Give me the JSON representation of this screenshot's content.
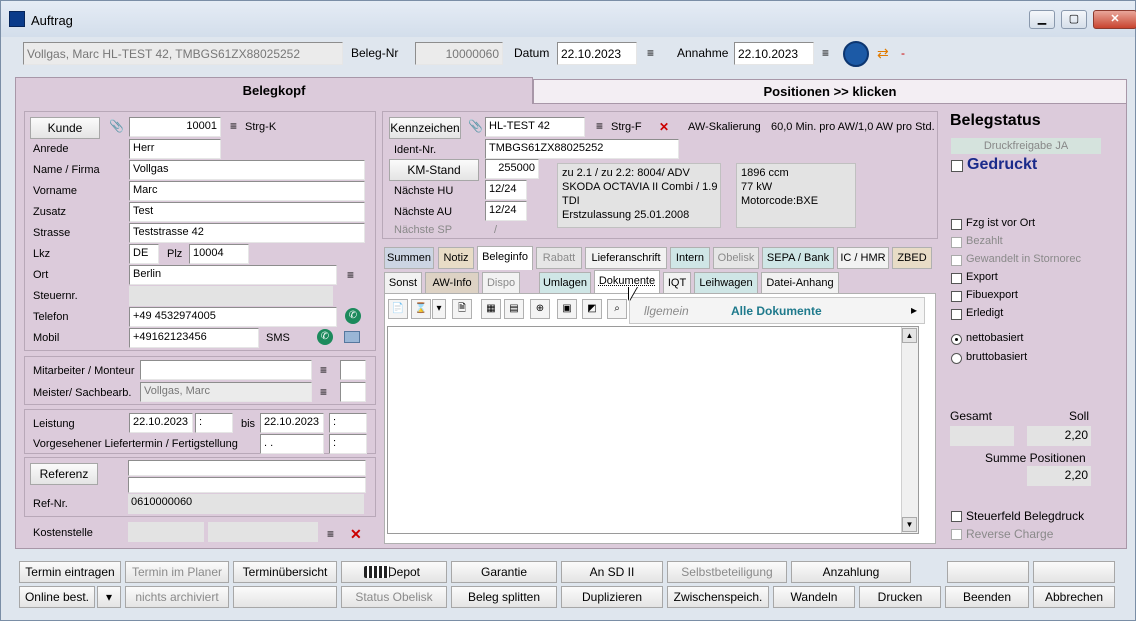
{
  "window": {
    "title": "Auftrag"
  },
  "header": {
    "customer_summary": "Vollgas, Marc HL-TEST 42, TMBGS61ZX88025252",
    "beleg_label": "Beleg-Nr",
    "beleg_nr": "10000060",
    "datum_label": "Datum",
    "datum": "22.10.2023",
    "annahme_label": "Annahme",
    "annahme": "22.10.2023",
    "dash": "-"
  },
  "main_tabs": {
    "belegkopf": "Belegkopf",
    "positionen": "Positionen >> klicken"
  },
  "kunde": {
    "btn": "Kunde",
    "nr": "10001",
    "strg": "Strg-K",
    "anrede_label": "Anrede",
    "anrede": "Herr",
    "name_label": "Name / Firma",
    "name": "Vollgas",
    "vorname_label": "Vorname",
    "vorname": "Marc",
    "zusatz_label": "Zusatz",
    "zusatz": "Test",
    "strasse_label": "Strasse",
    "strasse": "Teststrasse 42",
    "lkz_label": "Lkz",
    "lkz": "DE",
    "plz_label": "Plz",
    "plz": "10004",
    "ort_label": "Ort",
    "ort": "Berlin",
    "steuer_label": "Steuernr.",
    "steuer": "",
    "telefon_label": "Telefon",
    "telefon": "+49 4532974005",
    "mobil_label": "Mobil",
    "mobil": "+49162123456",
    "sms": "SMS"
  },
  "mitarbeiter": {
    "monteur_label": "Mitarbeiter / Monteur",
    "monteur": "",
    "meister_label": "Meister/ Sachbearb.",
    "meister": "Vollgas, Marc"
  },
  "leistung": {
    "label": "Leistung",
    "von": "22.10.2023",
    "von_zeit": ":",
    "bis_label": "bis",
    "bis": "22.10.2023",
    "bis_zeit": ":",
    "liefer_label": "Vorgesehener Liefertermin / Fertigstellung",
    "liefer": ". .",
    "liefer_zeit": ":"
  },
  "referenz": {
    "btn": "Referenz",
    "ref_nr_label": "Ref-Nr.",
    "ref_nr": "0610000060"
  },
  "kostenstelle": {
    "label": "Kostenstelle"
  },
  "fahrzeug": {
    "btn": "Kennzeichen",
    "kennzeichen": "HL-TEST 42",
    "strg": "Strg-F",
    "aw_label": "AW-Skalierung",
    "aw_value": "60,0 Min. pro AW/1,0 AW pro Std.",
    "ident_label": "Ident-Nr.",
    "ident": "TMBGS61ZX88025252",
    "km_btn": "KM-Stand",
    "km": "255000",
    "hu_label": "Nächste HU",
    "hu": "12/24",
    "au_label": "Nächste AU",
    "au": "12/24",
    "sp_label": "Nächste SP",
    "sp": "/",
    "info1": "zu 2.1 / zu 2.2: 8004/ ADV",
    "info2": "SKODA OCTAVIA II Combi / 1.9",
    "info3": "TDI",
    "info4": "Erstzulassung 25.01.2008",
    "ccm": "1896 ccm",
    "kw": "77 kW",
    "motor": "Motorcode:BXE"
  },
  "tabs_row1": [
    "Summen",
    "Notiz",
    "Beleginfo",
    "Rabatt",
    "Lieferanschrift",
    "Intern",
    "Obelisk",
    "SEPA / Bank",
    "IC / HMR",
    "ZBED"
  ],
  "tabs_row2": [
    "Sonst",
    "AW-Info",
    "Dispo",
    "Umlagen",
    "Dokumente",
    "IQT",
    "Leihwagen",
    "Datei-Anhang"
  ],
  "docs": {
    "menu_allgemein": "llgemein",
    "menu_alle": "Alle Dokumente",
    "arrow": "▸"
  },
  "status": {
    "title": "Belegstatus",
    "druckfreigabe": "Druckfreigabe JA",
    "gedruckt": "Gedruckt",
    "checks": [
      "Fzg ist vor Ort",
      "Bezahlt",
      "Gewandelt in Stornorec",
      "Export",
      "Fibuexport",
      "Erledigt"
    ],
    "netto": "nettobasiert",
    "brutto": "bruttobasiert",
    "gesamt_label": "Gesamt",
    "soll_label": "Soll",
    "gesamt": "",
    "soll": "2,20",
    "summe_label": "Summe Positionen",
    "summe": "2,20",
    "steuerfeld": "Steuerfeld Belegdruck",
    "reverse": "Reverse Charge"
  },
  "buttons_row1": [
    "Termin eintragen",
    "Termin im Planer",
    "Terminübersicht",
    "Depot",
    "Garantie",
    "An SD II",
    "Selbstbeteiligung",
    "Anzahlung",
    "",
    ""
  ],
  "buttons_row2": [
    "Online best.",
    "nichts archiviert",
    "",
    "Status Obelisk",
    "Beleg splitten",
    "Duplizieren",
    "Zwischenspeich.",
    "Wandeln",
    "Drucken",
    "Beenden",
    "Abbrechen"
  ],
  "icons": {
    "menu": "≡",
    "close_x": "✕",
    "clip": "📎",
    "phone": "✆"
  }
}
